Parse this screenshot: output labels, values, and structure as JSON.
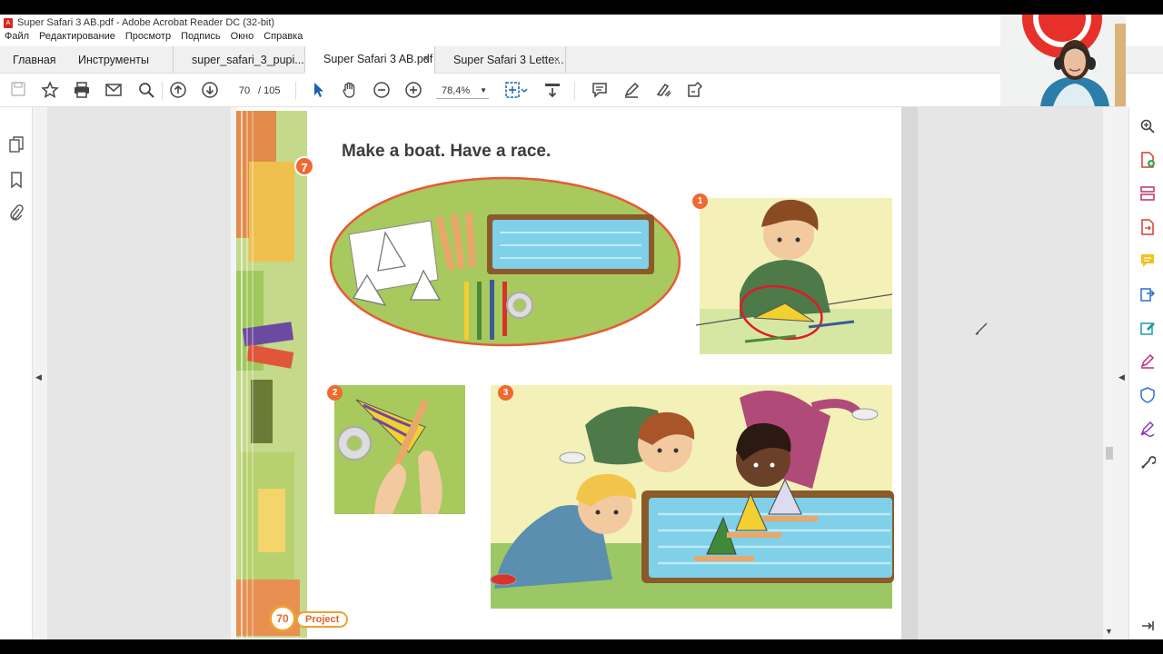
{
  "window": {
    "title": "Super Safari 3 AB.pdf - Adobe Acrobat Reader DC (32-bit)"
  },
  "menu": [
    "Файл",
    "Редактирование",
    "Просмотр",
    "Подпись",
    "Окно",
    "Справка"
  ],
  "tabs": {
    "home": "Главная",
    "tools": "Инструменты",
    "docs": [
      {
        "label": "super_safari_3_pupi..."
      },
      {
        "label": "Super Safari 3 AB.pdf"
      },
      {
        "label": "Super Safari 3 Lette..."
      }
    ],
    "close_glyph": "×"
  },
  "toolbar": {
    "page_current": "70",
    "page_total": "/ 105",
    "zoom": "78,4%"
  },
  "document": {
    "activity_number": "7",
    "heading": "Make a boat. Have a race.",
    "steps": [
      "1",
      "2",
      "3"
    ],
    "page_number": "70",
    "section_label": "Project"
  },
  "colors": {
    "accent_orange": "#ee6a33",
    "annotation_red": "#e0192a",
    "water_blue": "#7fd0e8",
    "grass_green": "#9cc765"
  },
  "icons": {
    "left_panel": [
      "pages-icon",
      "bookmark-icon",
      "attachment-icon"
    ],
    "right_panel": [
      "zoom-icon",
      "create-pdf-icon",
      "organize-pages-icon",
      "export-pdf-icon",
      "comment-icon",
      "send-for-signature-icon",
      "edit-pdf-icon",
      "fill-sign-icon",
      "protect-icon",
      "sign-icon",
      "more-tools-icon",
      "collapse-panel-icon"
    ]
  }
}
